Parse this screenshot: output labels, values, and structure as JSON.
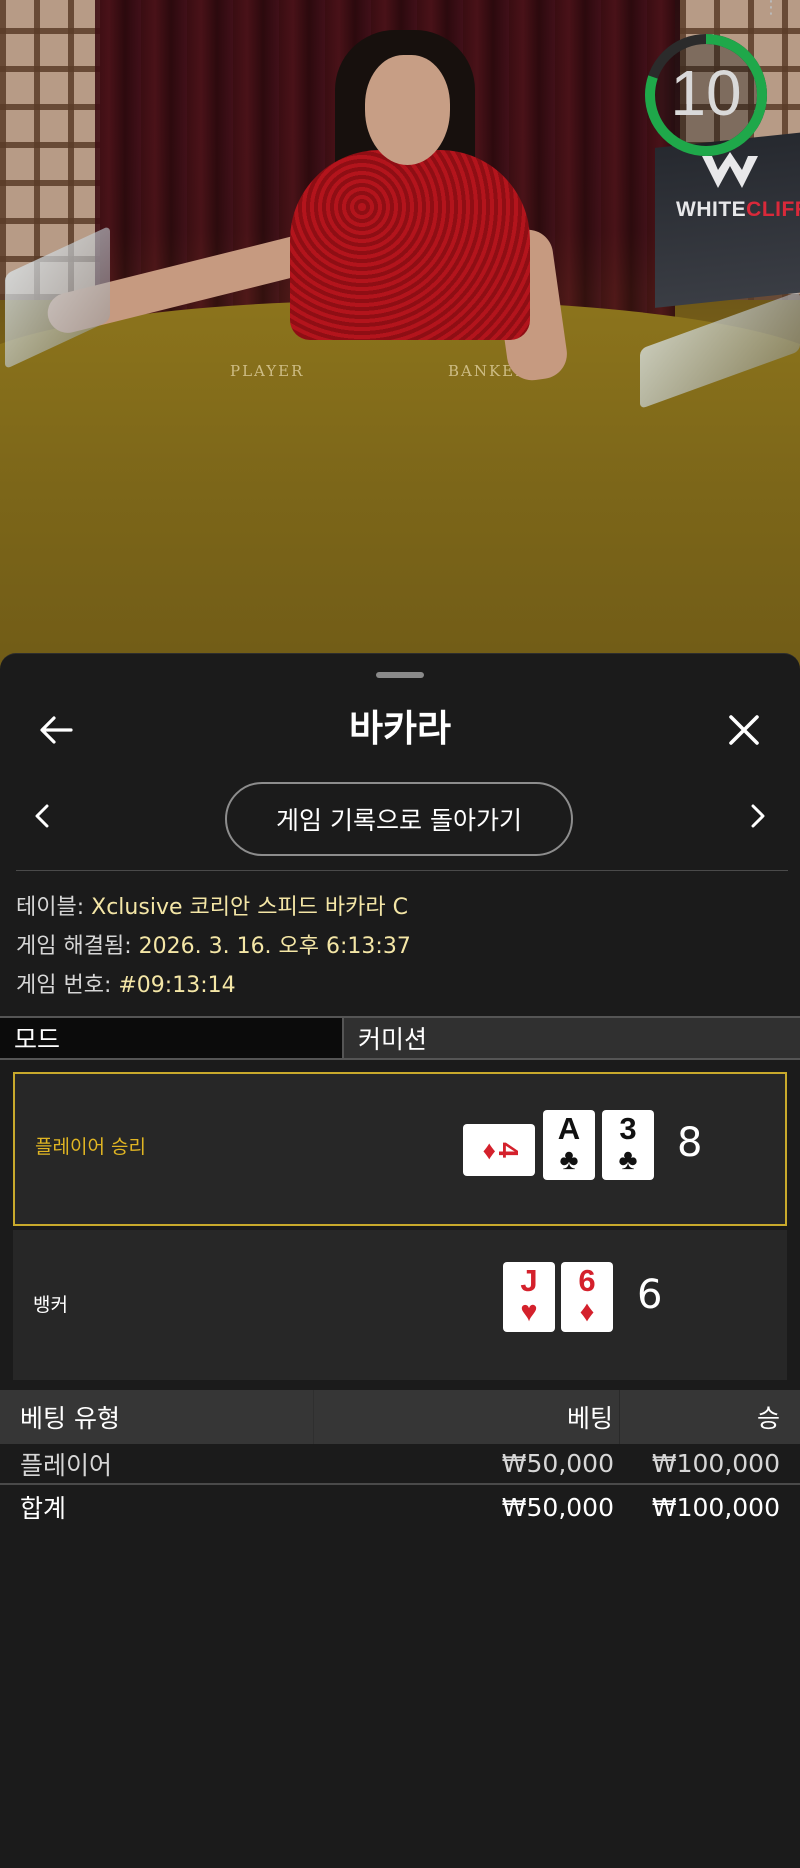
{
  "video": {
    "timer_value": "10",
    "timer_color": "#1fa84a",
    "brand_text": "WHITE",
    "brand_accent": "CLIFF",
    "felt_player": "PLAYER",
    "felt_banker": "BANKER"
  },
  "sheet": {
    "title": "바카라",
    "back_icon": "arrow-left-icon",
    "close_icon": "close-icon",
    "back_to_history_label": "게임 기록으로 돌아가기",
    "prev_icon": "chevron-left-icon",
    "next_icon": "chevron-right-icon"
  },
  "info": {
    "table_label": "테이블: ",
    "table_value": "Xclusive 코리안 스피드 바카라 C",
    "resolved_label": "게임 해결됨: ",
    "resolved_value": "2026. 3. 16. 오후 6:13:37",
    "game_no_label": "게임 번호: ",
    "game_no_value": "#09:13:14"
  },
  "mode": {
    "left": "모드",
    "right": "커미션"
  },
  "results": {
    "player": {
      "label": "플레이어 승리",
      "label_color": "#e0b523",
      "score": "8",
      "cards": [
        {
          "rank": "4",
          "suit": "♦",
          "color": "red",
          "orientation": "sideways"
        },
        {
          "rank": "A",
          "suit": "♣",
          "color": "black"
        },
        {
          "rank": "3",
          "suit": "♣",
          "color": "black"
        }
      ]
    },
    "banker": {
      "label": "뱅커",
      "score": "6",
      "cards": [
        {
          "rank": "J",
          "suit": "♥",
          "color": "red"
        },
        {
          "rank": "6",
          "suit": "♦",
          "color": "red"
        }
      ]
    }
  },
  "bets": {
    "headers": [
      "베팅 유형",
      "베팅",
      "승"
    ],
    "rows": [
      {
        "type": "플레이어",
        "bet": "₩50,000",
        "win": "₩100,000"
      }
    ],
    "total": {
      "label": "합계",
      "bet": "₩50,000",
      "win": "₩100,000"
    }
  },
  "colors": {
    "sheet_bg": "#1b1b1b",
    "win_border": "#c8a92c",
    "info_value": "#f4e6a6"
  }
}
